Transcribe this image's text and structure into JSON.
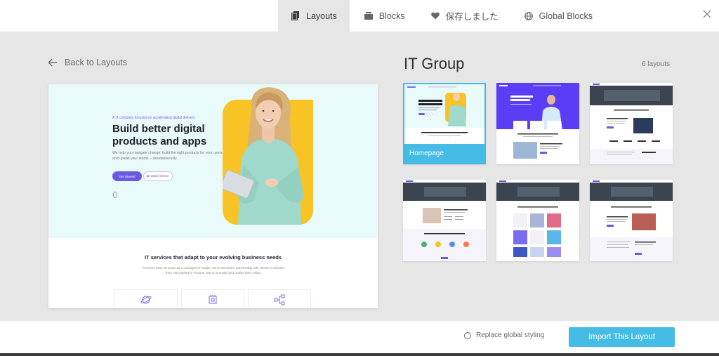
{
  "tabs": [
    {
      "label": "Layouts",
      "icon": "layouts-icon",
      "active": true
    },
    {
      "label": "Blocks",
      "icon": "blocks-icon",
      "active": false
    },
    {
      "label": "保存しました",
      "icon": "heart-icon",
      "active": false
    },
    {
      "label": "Global Blocks",
      "icon": "globe-icon",
      "active": false
    }
  ],
  "back_label": "Back to Layouts",
  "preview": {
    "hero_tag": "A IT company focused on accelerating digital delivery",
    "hero_title": "Build better digital products and apps",
    "hero_sub": "We help you navigate change, build the right products for your users and upskill your teams – simultaneously.",
    "btn_primary": "Get Started",
    "btn_secondary": "▶ Watch Demo",
    "section2_title": "IT services that adapt to your evolving business needs",
    "section2_sub": "For more than 20 years as a managed IT leader, we've worked in partnership with clients of all sizes from mid-market to Fortune 100 to innovate and realize their vision."
  },
  "group": {
    "title": "IT Group",
    "count": "6 layouts"
  },
  "thumbnails": [
    {
      "label": "Homepage",
      "active": true
    }
  ],
  "footer": {
    "replace_label": "Replace global styling",
    "import_label": "Import This Layout"
  },
  "colors": {
    "accent": "#45bce6",
    "hero_bg": "#e9fafa",
    "brand_purple": "#6a5ae0",
    "photo_yellow": "#f7c325"
  }
}
